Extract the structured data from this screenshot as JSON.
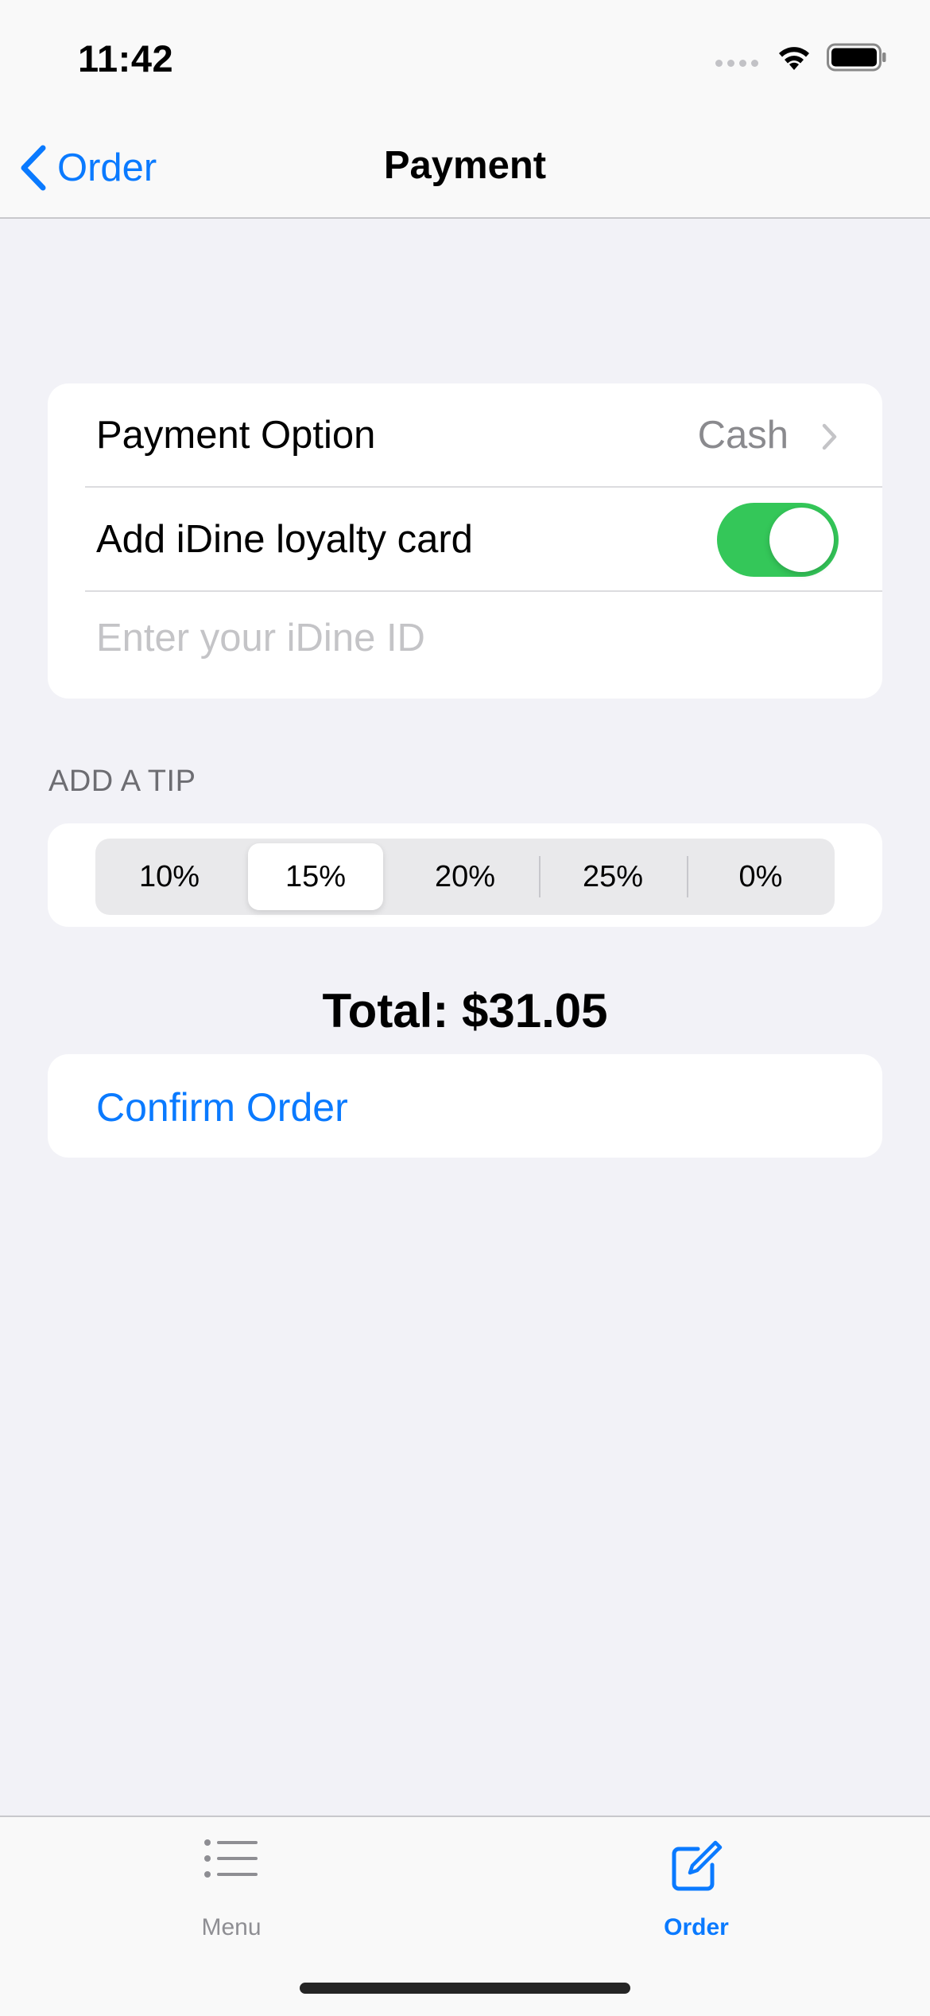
{
  "status_bar": {
    "time": "11:42"
  },
  "nav": {
    "back_label": "Order",
    "title": "Payment"
  },
  "form": {
    "payment_option_label": "Payment Option",
    "payment_option_value": "Cash",
    "loyalty_label": "Add iDine loyalty card",
    "loyalty_enabled": true,
    "id_placeholder": "Enter your iDine ID",
    "id_value": ""
  },
  "tip": {
    "header": "ADD A TIP",
    "options": [
      "10%",
      "15%",
      "20%",
      "25%",
      "0%"
    ],
    "selected": "15%"
  },
  "total": "Total: $31.05",
  "confirm_label": "Confirm Order",
  "tabs": [
    {
      "label": "Menu",
      "icon": "list-icon",
      "selected": false
    },
    {
      "label": "Order",
      "icon": "square-pencil-icon",
      "selected": true
    }
  ],
  "colors": {
    "accent": "#0a7aff",
    "toggle_on": "#34c759",
    "background": "#f2f2f7"
  }
}
